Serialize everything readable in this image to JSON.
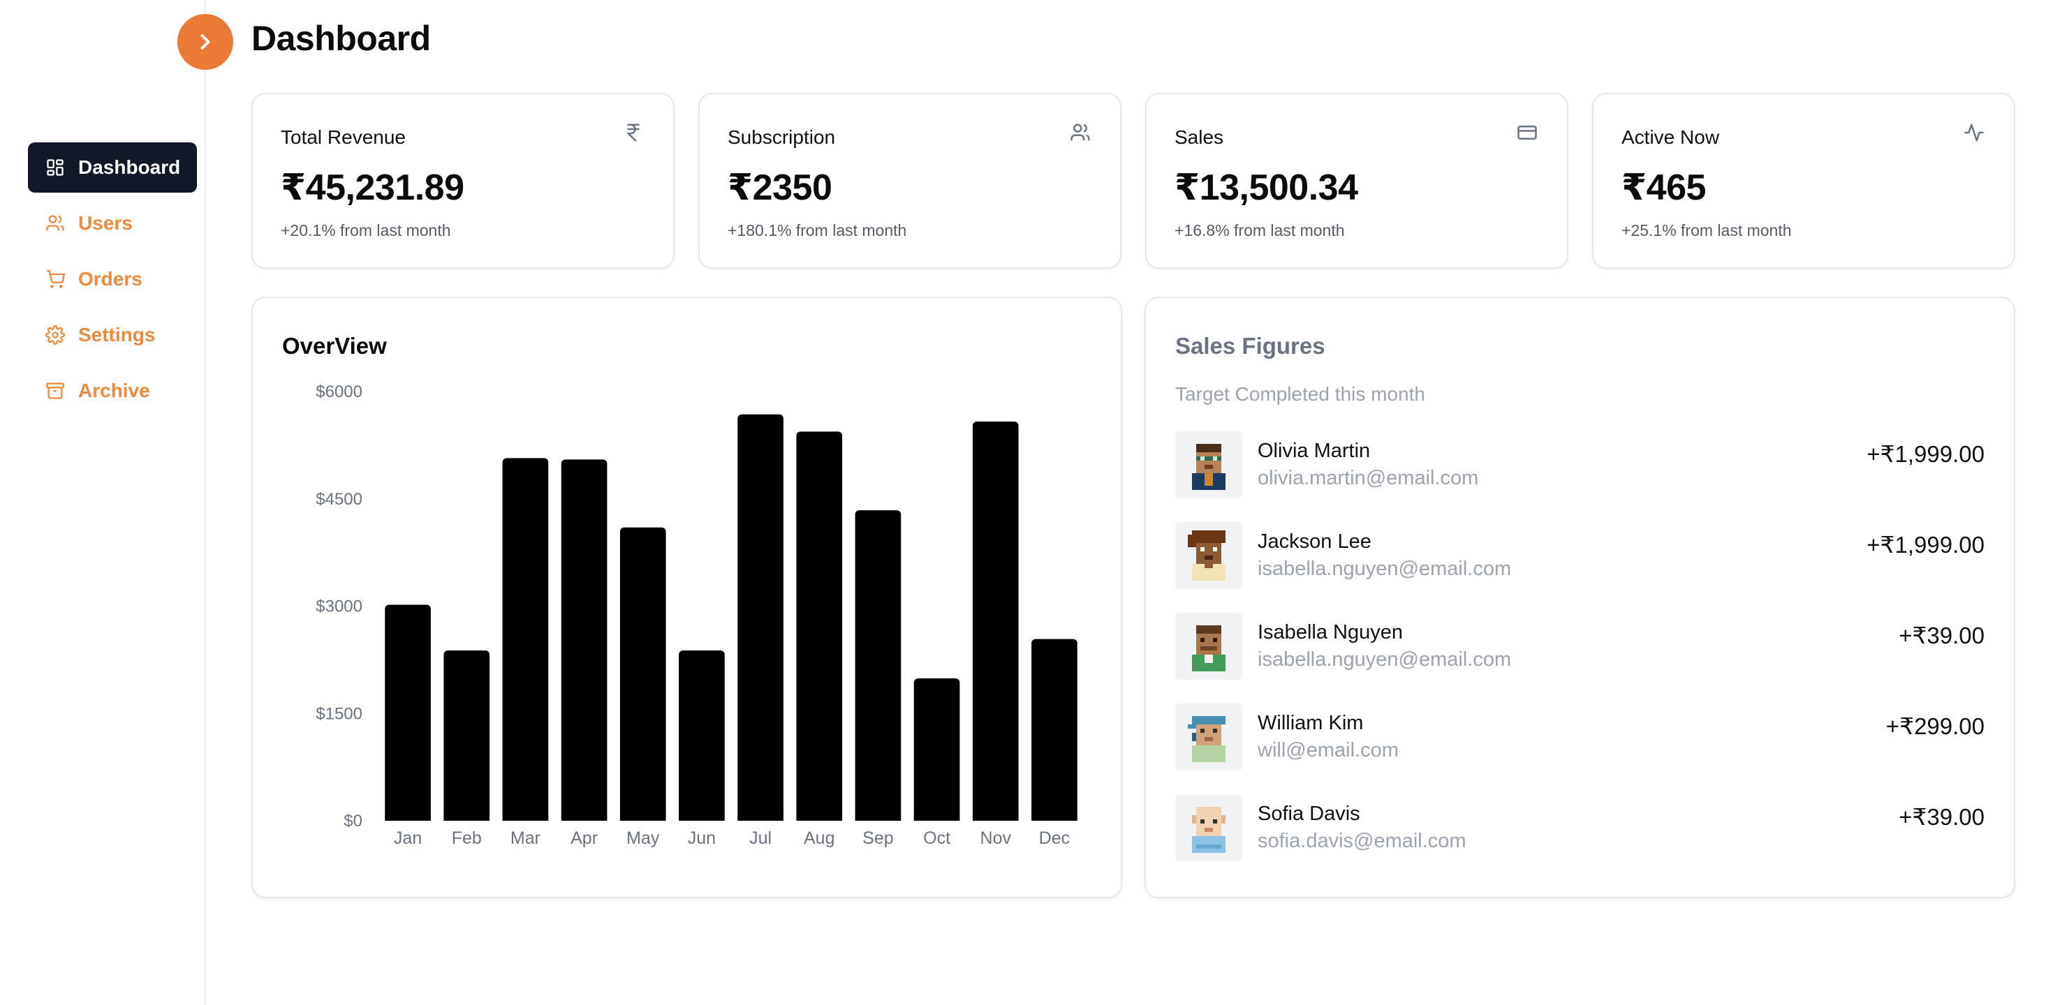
{
  "header": {
    "title": "Dashboard"
  },
  "sidebar": {
    "items": [
      {
        "label": "Dashboard",
        "icon": "layout-grid-icon",
        "active": true
      },
      {
        "label": "Users",
        "icon": "users-icon",
        "active": false
      },
      {
        "label": "Orders",
        "icon": "cart-icon",
        "active": false
      },
      {
        "label": "Settings",
        "icon": "gear-icon",
        "active": false
      },
      {
        "label": "Archive",
        "icon": "archive-icon",
        "active": false
      }
    ]
  },
  "stats": [
    {
      "label": "Total Revenue",
      "value": "₹45,231.89",
      "change": "+20.1% from last month",
      "icon": "rupee-icon"
    },
    {
      "label": "Subscription",
      "value": "₹2350",
      "change": "+180.1% from last month",
      "icon": "users-icon"
    },
    {
      "label": "Sales",
      "value": "₹13,500.34",
      "change": "+16.8% from last month",
      "icon": "credit-card-icon"
    },
    {
      "label": "Active Now",
      "value": "₹465",
      "change": "+25.1% from last month",
      "icon": "activity-icon"
    }
  ],
  "overview": {
    "title": "OverView"
  },
  "chart_data": {
    "type": "bar",
    "categories": [
      "Jan",
      "Feb",
      "Mar",
      "Apr",
      "May",
      "Jun",
      "Jul",
      "Aug",
      "Sep",
      "Oct",
      "Nov",
      "Dec"
    ],
    "values": [
      3020,
      2380,
      5070,
      5050,
      4100,
      2380,
      5680,
      5440,
      4340,
      1990,
      5580,
      2540
    ],
    "ylim": [
      0,
      6000
    ],
    "yticks": [
      0,
      1500,
      3000,
      4500,
      6000
    ],
    "ytick_labels": [
      "$0",
      "$1500",
      "$3000",
      "$4500",
      "$6000"
    ],
    "grid": false,
    "bar_color": "#000000"
  },
  "sales": {
    "title": "Sales Figures",
    "subtitle": "Target Completed this month",
    "rows": [
      {
        "name": "Olivia Martin",
        "email": "olivia.martin@email.com",
        "amount": "+₹1,999.00",
        "avatar": "pixel-avatar-glasses-icon"
      },
      {
        "name": "Jackson Lee",
        "email": "isabella.nguyen@email.com",
        "amount": "+₹1,999.00",
        "avatar": "pixel-avatar-brown-hair-icon"
      },
      {
        "name": "Isabella Nguyen",
        "email": "isabella.nguyen@email.com",
        "amount": "+₹39.00",
        "avatar": "pixel-avatar-green-shirt-icon"
      },
      {
        "name": "William Kim",
        "email": "will@email.com",
        "amount": "+₹299.00",
        "avatar": "pixel-avatar-blue-cap-icon"
      },
      {
        "name": "Sofia Davis",
        "email": "sofia.davis@email.com",
        "amount": "+₹39.00",
        "avatar": "pixel-avatar-bald-icon"
      }
    ]
  },
  "colors": {
    "accent": "#ea7a35",
    "nav_active_bg": "#111827",
    "muted": "#9ca3af"
  }
}
